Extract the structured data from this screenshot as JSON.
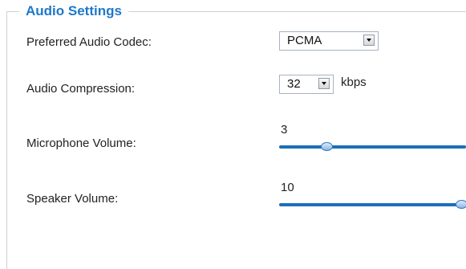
{
  "panel": {
    "legend": "Audio Settings"
  },
  "codec": {
    "label": "Preferred Audio Codec:",
    "value": "PCMA"
  },
  "compression": {
    "label": "Audio Compression:",
    "value": "32",
    "unit": "kbps"
  },
  "microphone": {
    "label": "Microphone Volume:",
    "value": "3",
    "level": 0.24
  },
  "speaker": {
    "label": "Speaker Volume:",
    "value": "10",
    "level": 1.0
  },
  "colors": {
    "accent": "#1e78c8",
    "slider_track": "#1d6fb6"
  }
}
